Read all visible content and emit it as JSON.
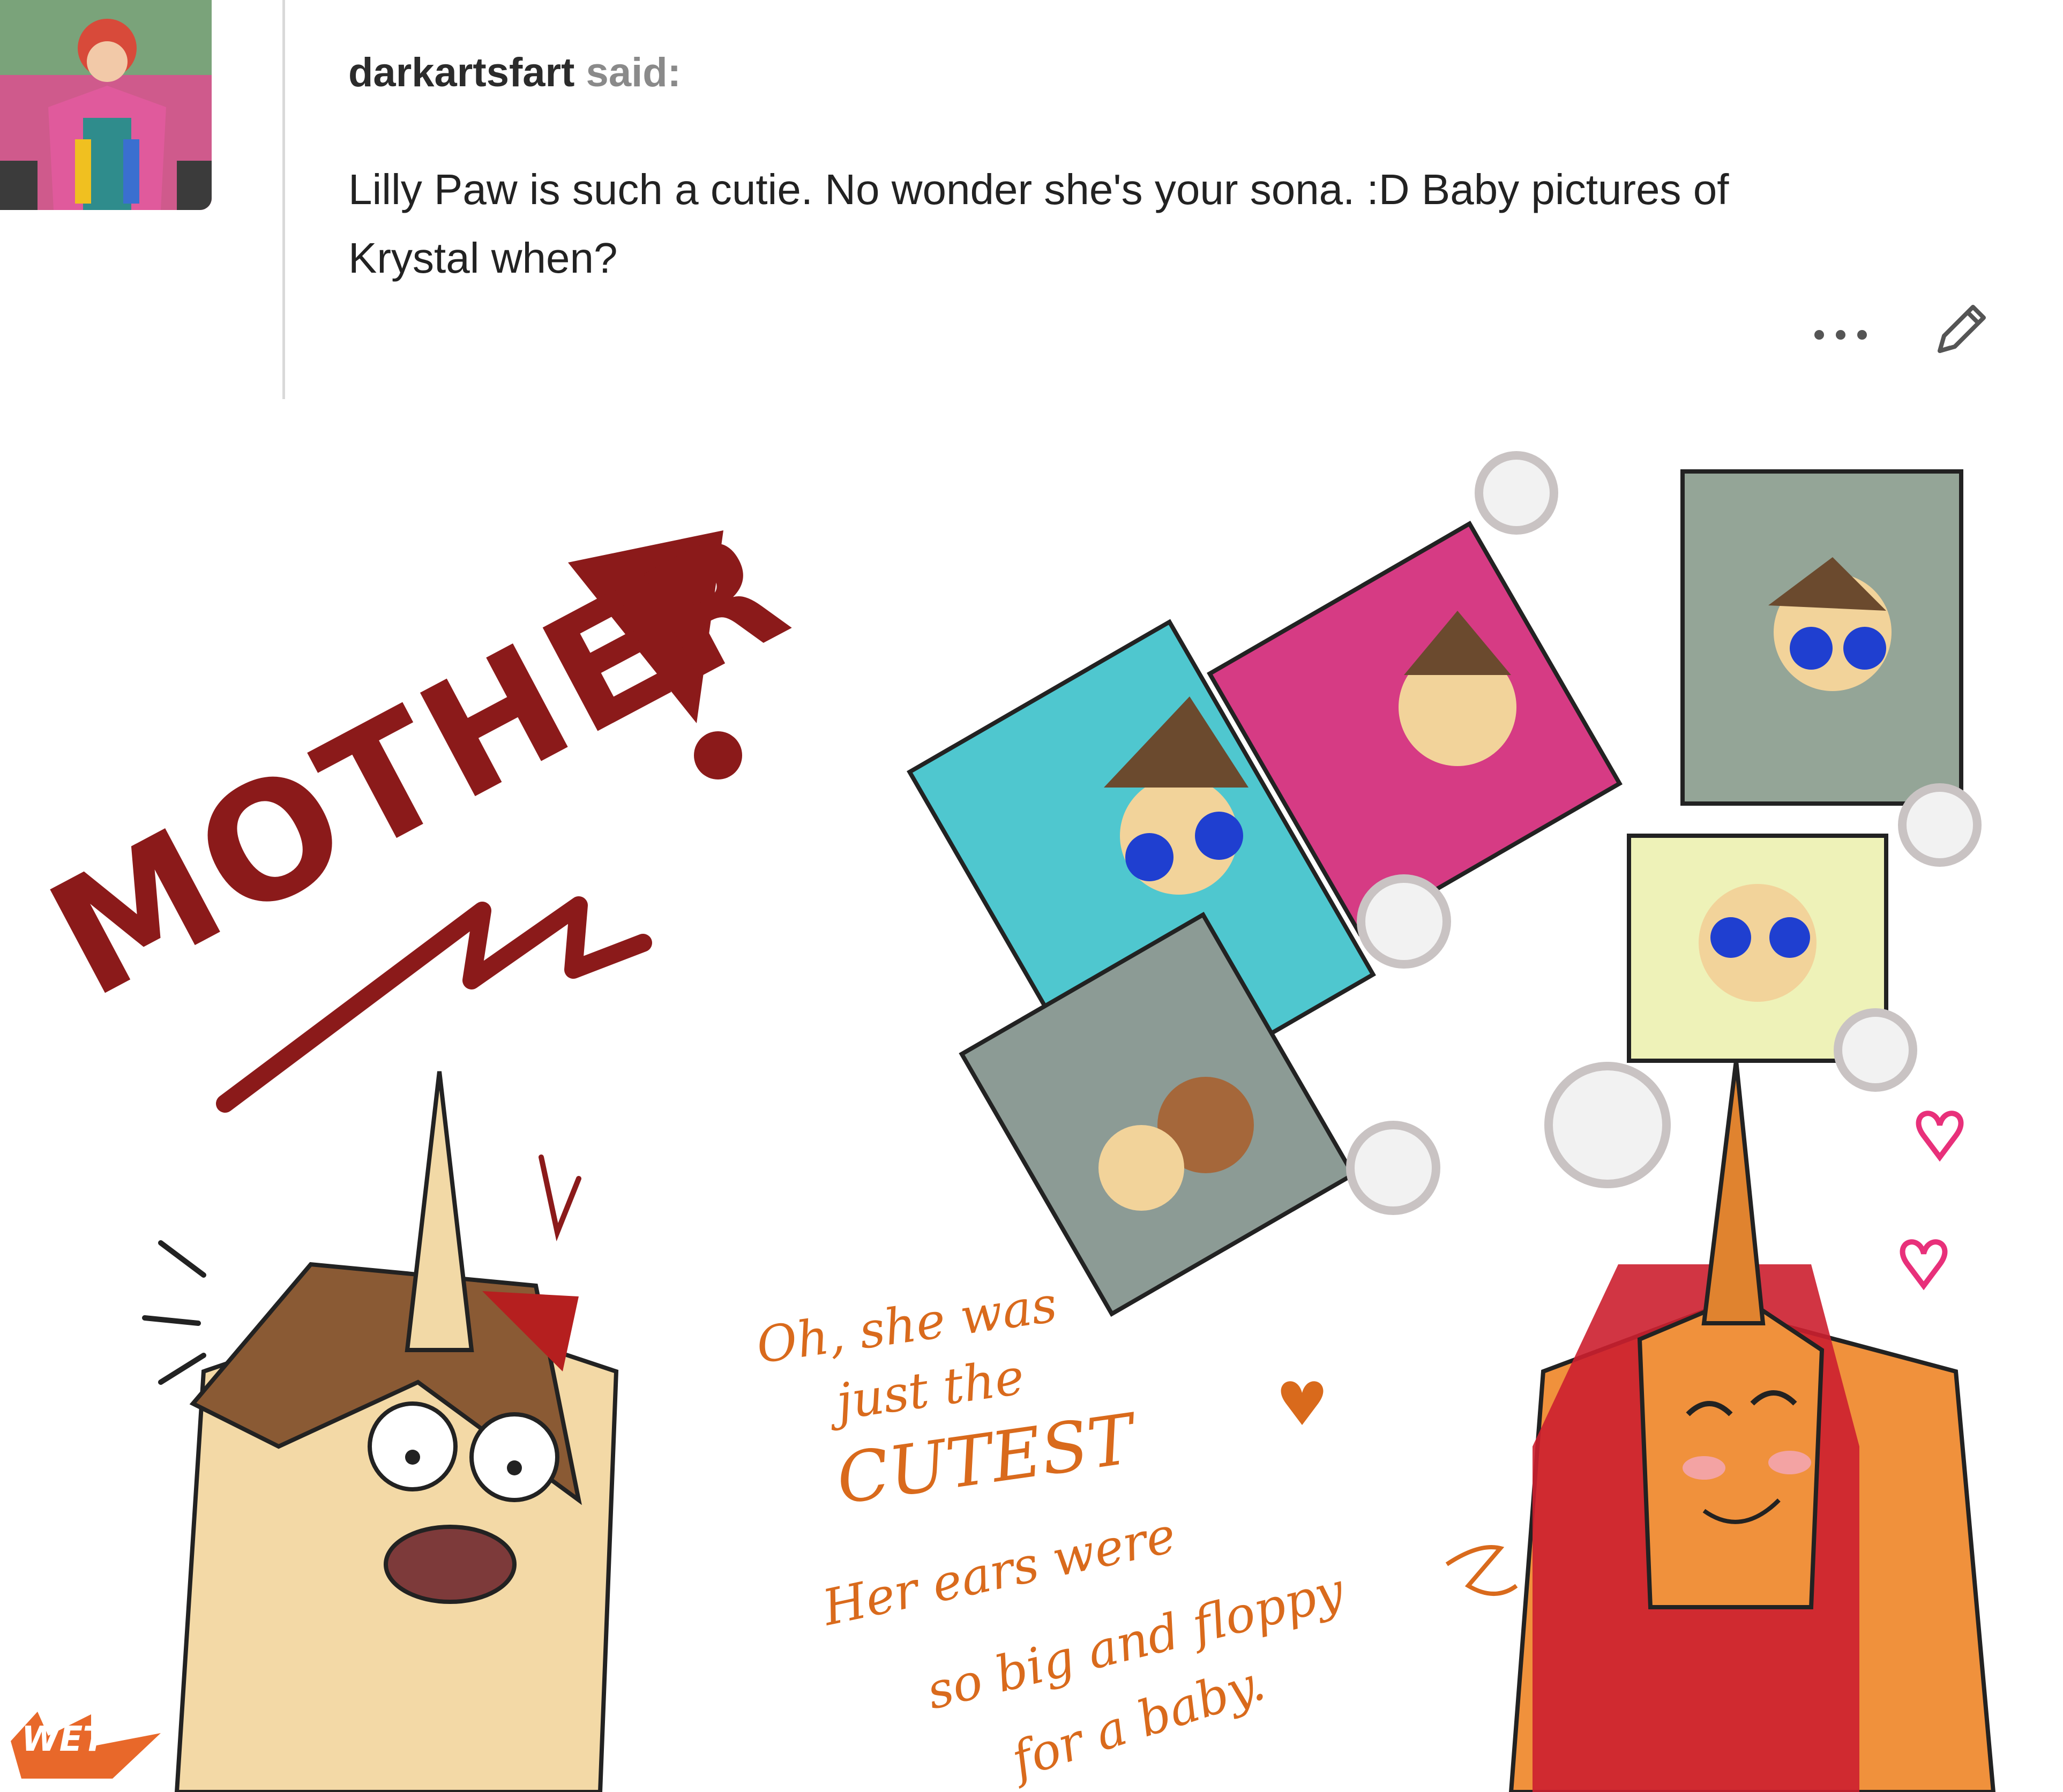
{
  "ask": {
    "username": "darkartsfart",
    "said": "said:",
    "message_line1": "Lilly Paw is such a cutie. No wonder she's your sona. :D Baby pictures of",
    "message_line2": "Krystal when?"
  },
  "icons": {
    "more": "more-dots-icon",
    "edit": "pencil-icon"
  },
  "comic": {
    "shout": "MOTHER",
    "mom_lines": [
      "Oh, she was",
      "just the",
      "CUTEST",
      "Her ears were",
      "so big and floppy",
      "for a baby."
    ],
    "signature": "WET"
  },
  "colors": {
    "shout": "#8b1a1a",
    "mom_text": "#d96a1c",
    "heart": "#e8307a"
  }
}
